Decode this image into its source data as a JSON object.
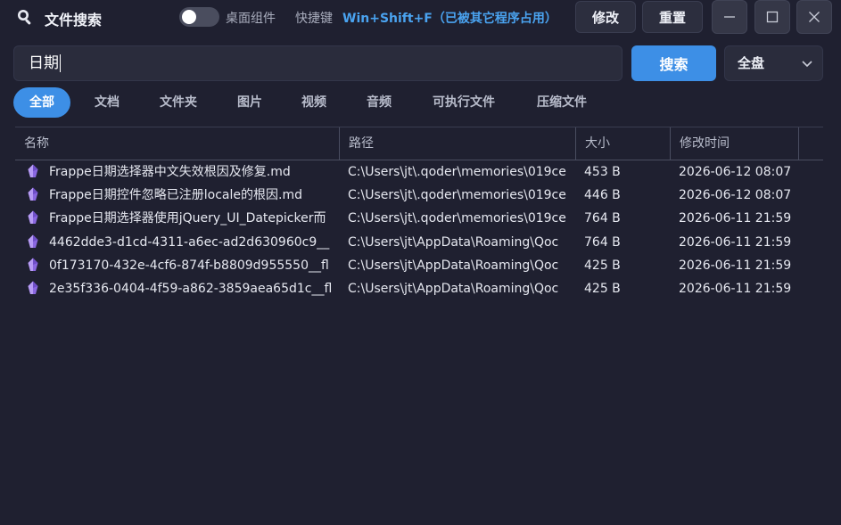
{
  "app": {
    "title": "文件搜索",
    "toggle_label": "桌面组件",
    "hotkey_label": "快捷键",
    "hotkey_value": "Win+Shift+F（已被其它程序占用）",
    "modify_label": "修改",
    "reset_label": "重置",
    "window_buttons": {
      "minimize": "—",
      "maximize": "☐",
      "close": "✕"
    }
  },
  "search": {
    "value": "日期",
    "button_label": "搜索",
    "scope_value": "全盘"
  },
  "tabs": [
    {
      "label": "全部",
      "active": true
    },
    {
      "label": "文档",
      "active": false
    },
    {
      "label": "文件夹",
      "active": false
    },
    {
      "label": "图片",
      "active": false
    },
    {
      "label": "视频",
      "active": false
    },
    {
      "label": "音频",
      "active": false
    },
    {
      "label": "可执行文件",
      "active": false
    },
    {
      "label": "压缩文件",
      "active": false
    }
  ],
  "table": {
    "columns": [
      "名称",
      "路径",
      "大小",
      "修改时间"
    ],
    "rows": [
      {
        "name": "Frappe日期选择器中文失效根因及修复.md",
        "path": "C:\\Users\\jt\\.qoder\\memories\\019ce",
        "size": "453 B",
        "mtime": "2026-06-12 08:07"
      },
      {
        "name": "Frappe日期控件忽略已注册locale的根因.md",
        "path": "C:\\Users\\jt\\.qoder\\memories\\019ce",
        "size": "446 B",
        "mtime": "2026-06-12 08:07"
      },
      {
        "name": "Frappe日期选择器使用jQuery_UI_Datepicker而",
        "path": "C:\\Users\\jt\\.qoder\\memories\\019ce",
        "size": "764 B",
        "mtime": "2026-06-11 21:59"
      },
      {
        "name": "4462dde3-d1cd-4311-a6ec-ad2d630960c9__",
        "path": "C:\\Users\\jt\\AppData\\Roaming\\Qoc",
        "size": "764 B",
        "mtime": "2026-06-11 21:59"
      },
      {
        "name": "0f173170-432e-4cf6-874f-b8809d955550__fl",
        "path": "C:\\Users\\jt\\AppData\\Roaming\\Qoc",
        "size": "425 B",
        "mtime": "2026-06-11 21:59"
      },
      {
        "name": "2e35f336-0404-4f59-a862-3859aea65d1c__fl",
        "path": "C:\\Users\\jt\\AppData\\Roaming\\Qoc",
        "size": "425 B",
        "mtime": "2026-06-11 21:59"
      }
    ]
  },
  "icons": {
    "app": "search-icon",
    "file": "crystal-file-icon",
    "scope": "chevron-down-icon"
  },
  "colors": {
    "accent": "#3d8fe6",
    "hotkey": "#4aa3f0",
    "file_icon": "#9b7be8",
    "background": "#1f2030"
  }
}
